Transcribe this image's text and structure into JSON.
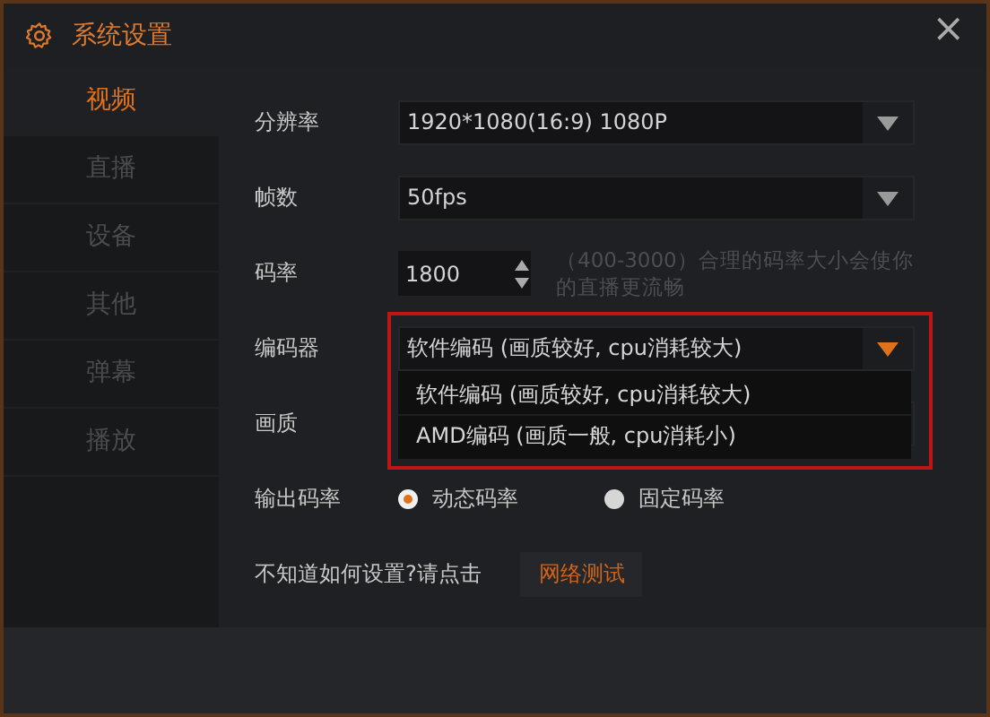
{
  "window": {
    "title": "系统设置",
    "close": "×"
  },
  "sidebar": {
    "items": [
      {
        "label": "视频",
        "selected": true
      },
      {
        "label": "直播",
        "selected": false
      },
      {
        "label": "设备",
        "selected": false
      },
      {
        "label": "其他",
        "selected": false
      },
      {
        "label": "弹幕",
        "selected": false
      },
      {
        "label": "播放",
        "selected": false
      }
    ]
  },
  "settings": [
    {
      "kind": "select",
      "label": "分辨率",
      "value": "1920*1080(16:9) 1080P",
      "expanded": false
    },
    {
      "kind": "select",
      "label": "帧数",
      "value": "50fps",
      "expanded": false
    },
    {
      "kind": "spinner",
      "label": "码率",
      "value": "1800",
      "hint": "（400-3000）合理的码率大小会使你的直播更流畅"
    },
    {
      "kind": "select",
      "label": "编码器",
      "value": "软件编码 (画质较好, cpu消耗较大)",
      "expanded": true,
      "options": [
        "软件编码 (画质较好, cpu消耗较大)",
        "AMD编码 (画质一般, cpu消耗小)"
      ]
    },
    {
      "kind": "select",
      "label": "画质",
      "expanded": false
    },
    {
      "kind": "radio",
      "label": "输出码率",
      "options": [
        {
          "label": "动态码率",
          "selected": true
        },
        {
          "label": "固定码率",
          "selected": false
        }
      ]
    },
    {
      "kind": "action",
      "label": "不知道如何设置?请点击",
      "button": "网络测试"
    }
  ]
}
